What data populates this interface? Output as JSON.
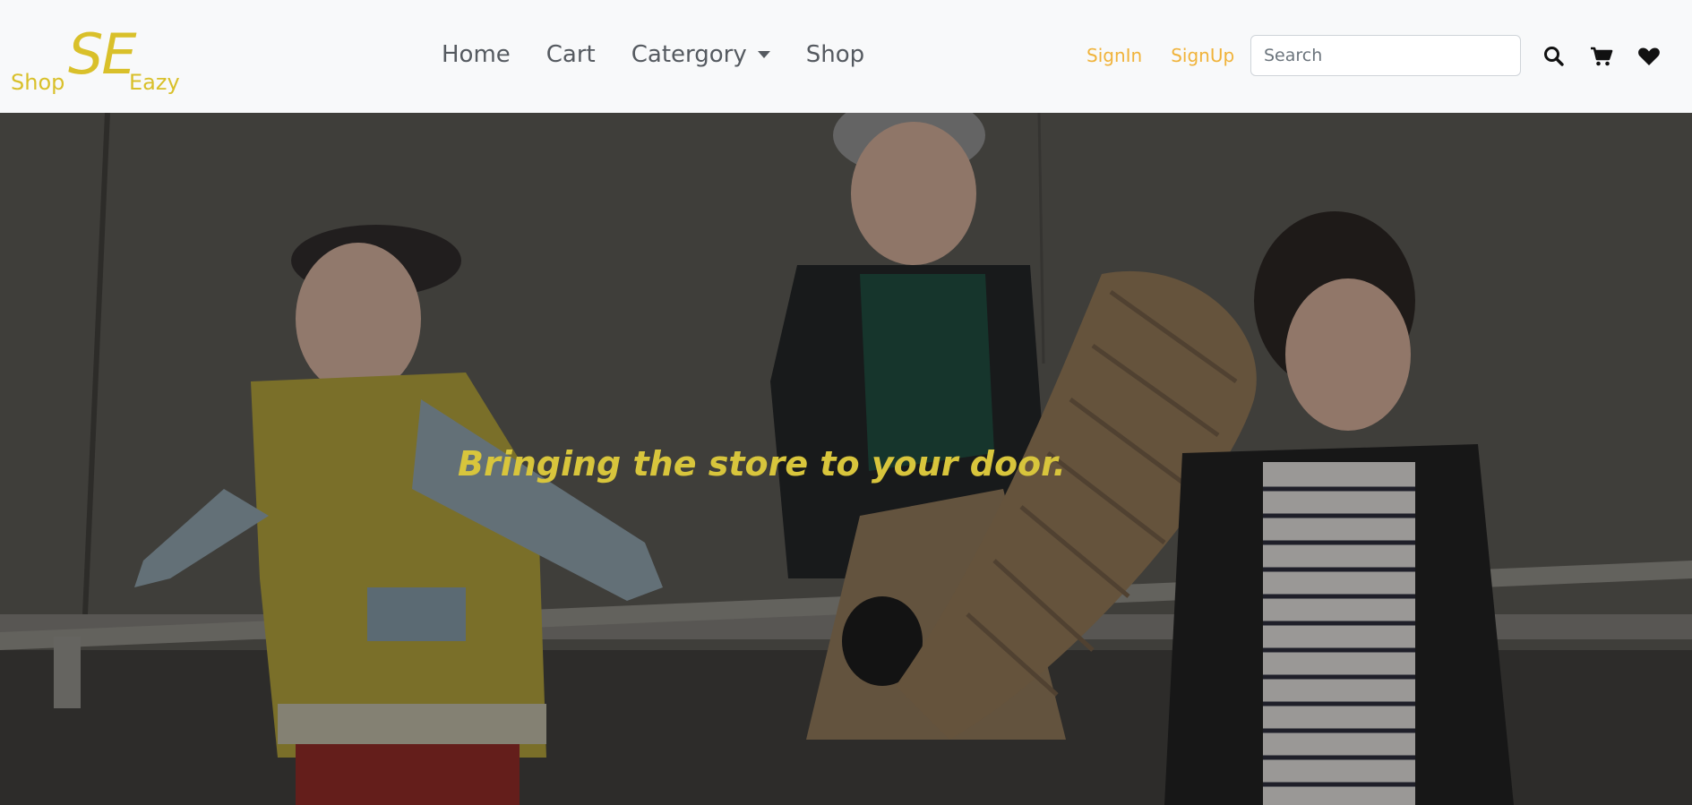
{
  "brand": {
    "left": "Shop",
    "center": "SE",
    "right": "Eazy"
  },
  "nav": {
    "items": [
      {
        "label": "Home"
      },
      {
        "label": "Cart"
      },
      {
        "label": "Catergory",
        "has_dropdown": true
      },
      {
        "label": "Shop"
      }
    ]
  },
  "auth": {
    "signin": "SignIn",
    "signup": "SignUp"
  },
  "search": {
    "placeholder": "Search",
    "value": ""
  },
  "icons": [
    "search-icon",
    "cart-icon",
    "heart-icon"
  ],
  "hero": {
    "tagline": "Bringing the store to your door."
  },
  "colors": {
    "brand": "#d9c02a",
    "auth_link": "#f0b33a",
    "tagline": "#d8c53c",
    "navbar_bg": "#f8f9fa"
  }
}
